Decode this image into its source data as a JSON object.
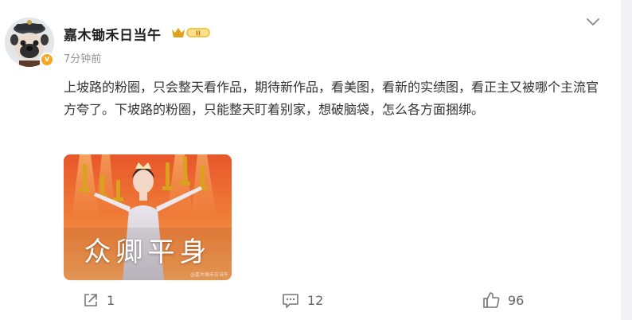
{
  "post": {
    "author": {
      "name": "嘉木锄禾日当午",
      "level_badge": "II",
      "verified_glyph": "v"
    },
    "time": "7分钟前",
    "text": "上坡路的粉圈，只会整天看作品，期待新作品，看美图，看新的实绩图，看正主又被哪个主流官方夸了。下坡路的粉圈，只能整天盯着别家，想破脑袋，怎么各方面捆绑。",
    "image": {
      "caption": "众卿平身",
      "watermark": "@嘉木锄禾日当午"
    },
    "actions": {
      "share_icon": "share-icon",
      "share_count": "1",
      "comment_icon": "comment-icon",
      "comment_count": "12",
      "like_icon": "thumbs-up-icon",
      "like_count": "96"
    }
  },
  "colors": {
    "accent": "#f5a623",
    "text": "#333333",
    "muted": "#939393",
    "background": "#f3f3f5"
  }
}
